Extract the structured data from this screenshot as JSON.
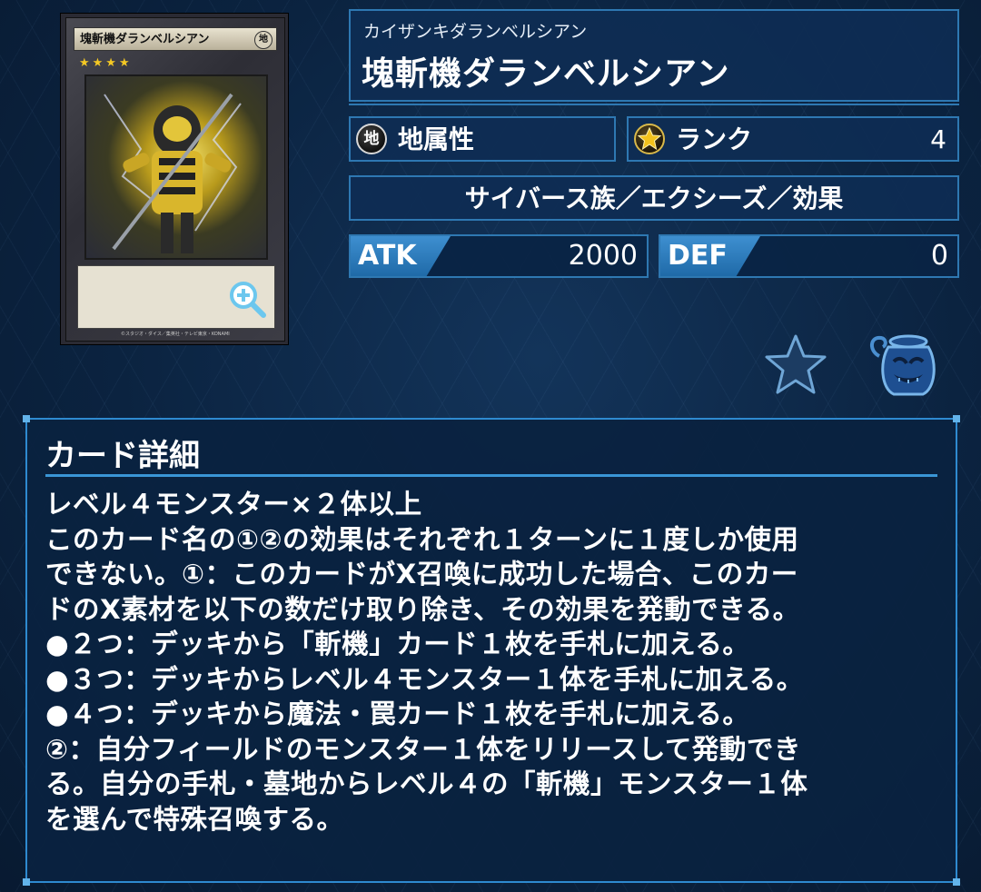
{
  "card_image": {
    "name_text": "塊斬機ダランベルシアン",
    "attribute_char": "地",
    "stars": "★★★★",
    "copyright": "©スタジオ・ダイス／集英社・テレビ東京・KONAMI"
  },
  "header": {
    "ruby": "カイザンキダランベルシアン",
    "title": "塊斬機ダランベルシアン"
  },
  "attribute": {
    "icon_char": "地",
    "label": "地属性"
  },
  "rank": {
    "label": "ランク",
    "value": "4"
  },
  "type_line": "サイバース族／エクシーズ／効果",
  "stats": {
    "atk_label": "ATK",
    "atk_value": "2000",
    "def_label": "DEF",
    "def_value": "0"
  },
  "colors": {
    "panel_border": "#2e78b2",
    "accent": "#3e8fd0",
    "background": "#0b2340"
  },
  "icons": [
    "zoom-icon",
    "favorite-star-icon",
    "pot-icon"
  ],
  "details": {
    "heading": "カード詳細",
    "lines": [
      "レベル４モンスター×２体以上",
      "このカード名の①②の効果はそれぞれ１ターンに１度しか使用",
      "できない。①：このカードがX召喚に成功した場合、このカー",
      "ドのX素材を以下の数だけ取り除き、その効果を発動できる。",
      "●２つ：デッキから「斬機」カード１枚を手札に加える。",
      "●３つ：デッキからレベル４モンスター１体を手札に加える。",
      "●４つ：デッキから魔法・罠カード１枚を手札に加える。",
      "②：自分フィールドのモンスター１体をリリースして発動でき",
      "る。自分の手札・墓地からレベル４の「斬機」モンスター１体",
      "を選んで特殊召喚する。"
    ]
  }
}
